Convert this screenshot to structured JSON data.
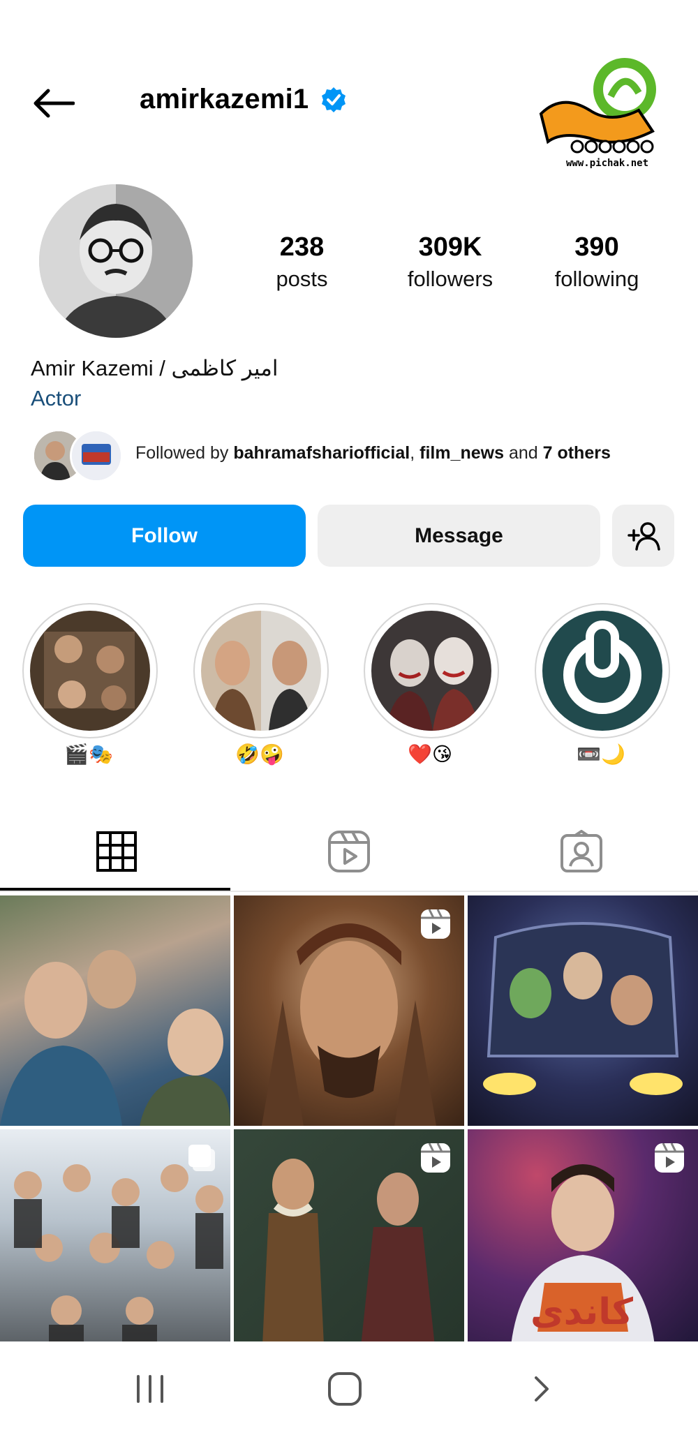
{
  "header": {
    "username": "amirkazemi1",
    "verified": true,
    "logo_url_text": "www.pichak.net",
    "icons": {
      "back": "arrow-left-icon",
      "verified": "verified-badge-icon"
    }
  },
  "profile": {
    "stats": [
      {
        "value": "238",
        "label": "posts"
      },
      {
        "value": "309K",
        "label": "followers"
      },
      {
        "value": "390",
        "label": "following"
      }
    ],
    "full_name": "Amir Kazemi / امیر کاظمی",
    "category": "Actor",
    "followed_by": {
      "prefix": "Followed by ",
      "names": [
        "bahramafshariofficial",
        "film_news"
      ],
      "separator": ", ",
      "connector": " and ",
      "others": "7 others"
    }
  },
  "actions": {
    "follow": "Follow",
    "message": "Message",
    "add_user_icon": "add-user-icon"
  },
  "highlights": [
    {
      "label": "🎬🎭"
    },
    {
      "label": "🤣🤪"
    },
    {
      "label": "❤️😘"
    },
    {
      "label": "📼🌙"
    }
  ],
  "tabs": [
    {
      "name": "grid",
      "icon": "grid-icon",
      "active": true
    },
    {
      "name": "reels",
      "icon": "reels-icon",
      "active": false
    },
    {
      "name": "tagged",
      "icon": "tagged-icon",
      "active": false
    }
  ],
  "posts": [
    {
      "type": "image"
    },
    {
      "type": "reel"
    },
    {
      "type": "image"
    },
    {
      "type": "carousel"
    },
    {
      "type": "reel"
    },
    {
      "type": "reel",
      "overlay_text": "کاندی"
    }
  ],
  "colors": {
    "accent": "#0095f6",
    "category": "#1a4f7a",
    "button_bg": "#efefef"
  }
}
